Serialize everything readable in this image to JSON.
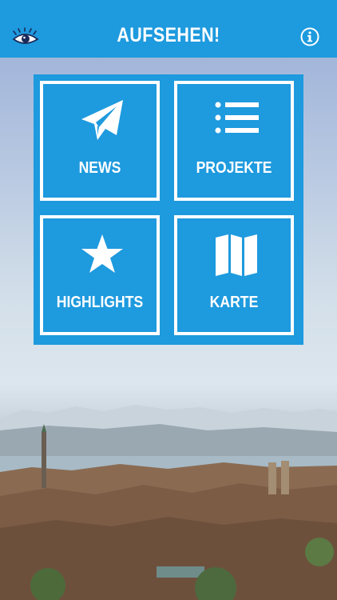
{
  "header": {
    "title": "AUFSEHEN!",
    "left_icon": "eye-icon",
    "right_icon": "info-icon"
  },
  "menu": {
    "tiles": [
      {
        "label": "NEWS",
        "icon": "paper-plane-icon"
      },
      {
        "label": "PROJEKTE",
        "icon": "list-icon"
      },
      {
        "label": "HIGHLIGHTS",
        "icon": "star-icon"
      },
      {
        "label": "KARTE",
        "icon": "map-icon"
      }
    ]
  },
  "colors": {
    "accent": "#1e9ade",
    "text": "#ffffff"
  }
}
